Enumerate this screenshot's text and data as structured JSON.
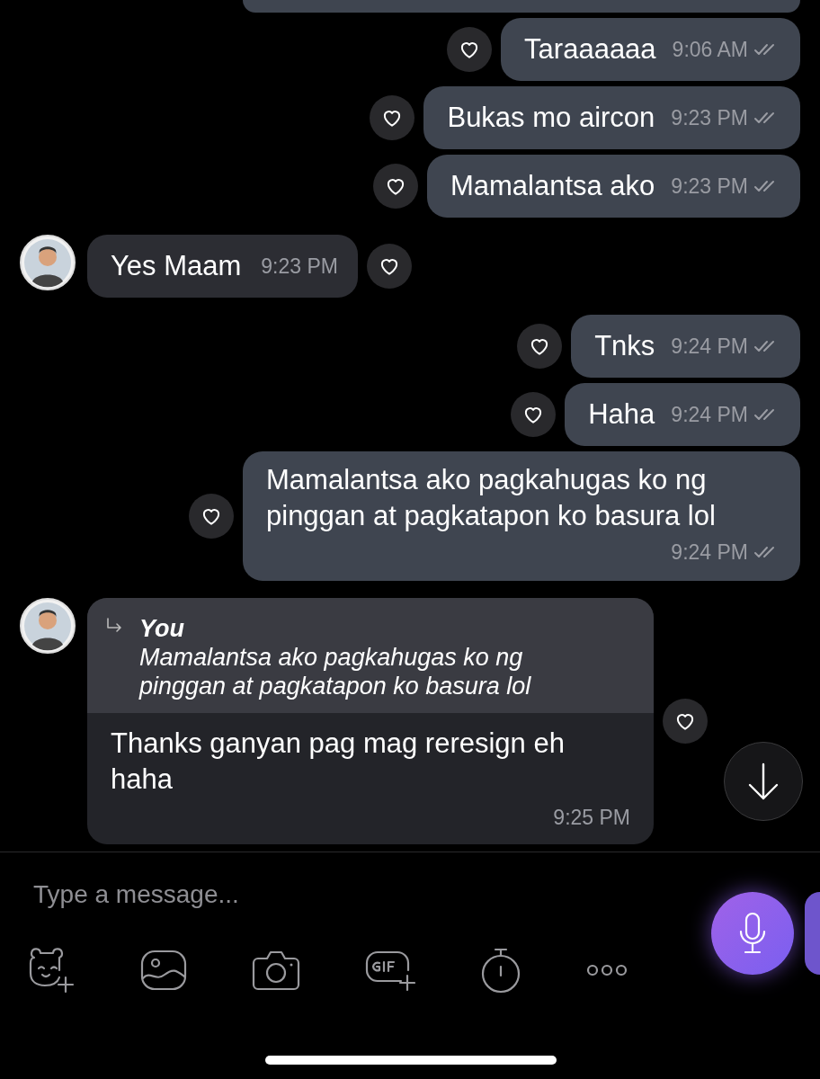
{
  "messages": [
    {
      "kind": "outgoing_cut"
    },
    {
      "kind": "outgoing",
      "text": "Taraaaaaa",
      "time": "9:06 AM",
      "seen": true,
      "liked": false
    },
    {
      "kind": "outgoing",
      "text": "Bukas mo aircon",
      "time": "9:23 PM",
      "seen": true,
      "liked": false
    },
    {
      "kind": "outgoing",
      "text": "Mamalantsa ako",
      "time": "9:23 PM",
      "seen": true,
      "liked": false
    },
    {
      "kind": "incoming",
      "text": "Yes Maam",
      "time": "9:23 PM",
      "liked": false
    },
    {
      "kind": "outgoing",
      "text": "Tnks",
      "time": "9:24 PM",
      "seen": true,
      "liked": false
    },
    {
      "kind": "outgoing",
      "text": "Haha",
      "time": "9:24 PM",
      "seen": true,
      "liked": false
    },
    {
      "kind": "outgoing",
      "text": "Mamalantsa ako pagkahugas ko ng pinggan at pagkatapon ko basura lol",
      "time": "9:24 PM",
      "seen": true,
      "liked": false
    },
    {
      "kind": "reply",
      "quote_author": "You",
      "quote_text": "Mamalantsa ako pagkahugas ko ng pinggan at pagkatapon ko basura lol",
      "text": "Thanks ganyan pag mag reresign eh haha",
      "time": "9:25 PM",
      "liked": false
    }
  ],
  "composer": {
    "placeholder": "Type a message..."
  }
}
